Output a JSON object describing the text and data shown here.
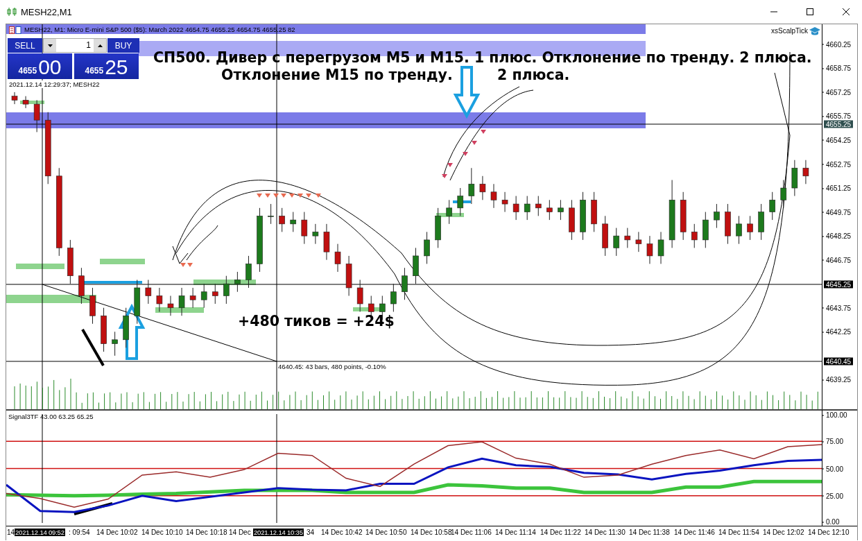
{
  "window": {
    "title": "MESH22,M1"
  },
  "chart": {
    "header": "MESH22, M1:  Micro E-mini S&P 500 ($5): March 2022  4654.75 4655.25 4654.75 4655.25  82",
    "server_time": "2021.12.14 12:29:37; MESH22",
    "expert": "xsScalpTick",
    "trade_panel": {
      "sell": {
        "label": "SELL",
        "price_base": "4655",
        "price_pips": "00"
      },
      "buy": {
        "label": "BUY",
        "price_base": "4655",
        "price_pips": "25"
      },
      "volume": "1"
    },
    "annotations": [
      "СП500. Дивер с перегрузом М5 и М15. 1 плюс. Отклонение по тренду. 2 плюса.",
      "Отклонение М15 по тренду.",
      "2 плюса.",
      "+480 тиков = +24$"
    ],
    "measure_label": "4640.45: 43 bars, 480 points, -0.10%",
    "price_markers": [
      {
        "text": "4655.25",
        "kind": "bid"
      },
      {
        "text": "4645.25",
        "kind": "line"
      },
      {
        "text": "4640.45",
        "kind": "line"
      }
    ],
    "chart_data": {
      "type": "candlestick",
      "ylim": [
        4637.4,
        4661.5
      ],
      "yticks": [
        {
          "value": 4660.25,
          "label": "4660.25"
        },
        {
          "value": 4658.75,
          "label": "4658.75"
        },
        {
          "value": 4657.25,
          "label": "4657.25"
        },
        {
          "value": 4655.75,
          "label": "4655.75"
        },
        {
          "value": 4654.25,
          "label": "4654.25"
        },
        {
          "value": 4652.75,
          "label": "4652.75"
        },
        {
          "value": 4651.25,
          "label": "4651.25"
        },
        {
          "value": 4649.75,
          "label": "4649.75"
        },
        {
          "value": 4648.25,
          "label": "4648.25"
        },
        {
          "value": 4646.75,
          "label": "4646.75"
        },
        {
          "value": 4643.75,
          "label": "4643.75"
        },
        {
          "value": 4642.25,
          "label": "4642.25"
        },
        {
          "value": 4639.25,
          "label": "4639.25"
        }
      ],
      "ohlc": [
        [
          4657,
          4657.25,
          4656.5,
          4656.75
        ],
        [
          4656.75,
          4657,
          4656.25,
          4656.5
        ],
        [
          4656.5,
          4656.75,
          4654.75,
          4655.5
        ],
        [
          4655.5,
          4656,
          4651.5,
          4652
        ],
        [
          4652,
          4652.5,
          4647,
          4647.5
        ],
        [
          4647.5,
          4648,
          4645.25,
          4645.75
        ],
        [
          4645.75,
          4646.25,
          4644,
          4644.5
        ],
        [
          4644.5,
          4645,
          4642.75,
          4643.25
        ],
        [
          4643.25,
          4643.75,
          4641,
          4641.5
        ],
        [
          4641.5,
          4642.25,
          4640.75,
          4641.75
        ],
        [
          4641.75,
          4643.75,
          4641.25,
          4643.25
        ],
        [
          4643.25,
          4645.5,
          4642.75,
          4645
        ],
        [
          4645,
          4645.5,
          4644,
          4644.5
        ],
        [
          4644.5,
          4645,
          4643.5,
          4644
        ],
        [
          4644,
          4644.5,
          4643.25,
          4643.75
        ],
        [
          4643.75,
          4645,
          4643.25,
          4644.5
        ],
        [
          4644.5,
          4645,
          4643.75,
          4644.25
        ],
        [
          4644.25,
          4645.25,
          4643.75,
          4644.75
        ],
        [
          4644.75,
          4645.25,
          4644,
          4644.5
        ],
        [
          4644.5,
          4645.75,
          4644,
          4645.25
        ],
        [
          4645.25,
          4646,
          4644.75,
          4645.5
        ],
        [
          4645.5,
          4647,
          4645,
          4646.5
        ],
        [
          4646.5,
          4650,
          4646,
          4649.5
        ],
        [
          4649.5,
          4650.25,
          4649,
          4649.5
        ],
        [
          4649.5,
          4650,
          4648.5,
          4649
        ],
        [
          4649,
          4649.75,
          4648.5,
          4649.25
        ],
        [
          4649.25,
          4649.75,
          4647.75,
          4648.25
        ],
        [
          4648.25,
          4649,
          4647.75,
          4648.5
        ],
        [
          4648.5,
          4649,
          4646.75,
          4647.25
        ],
        [
          4647.25,
          4647.75,
          4646,
          4646.5
        ],
        [
          4646.5,
          4647,
          4644.5,
          4645
        ],
        [
          4645,
          4645.5,
          4643.5,
          4644
        ],
        [
          4644,
          4644.5,
          4643,
          4643.5
        ],
        [
          4643.5,
          4644.5,
          4643,
          4644
        ],
        [
          4644,
          4645.25,
          4643.5,
          4644.75
        ],
        [
          4644.75,
          4646.25,
          4644.25,
          4645.75
        ],
        [
          4645.75,
          4647.5,
          4645.25,
          4647
        ],
        [
          4647,
          4648.5,
          4646.5,
          4648
        ],
        [
          4648,
          4650,
          4647.5,
          4649.5
        ],
        [
          4649.5,
          4650.5,
          4649,
          4650
        ],
        [
          4650,
          4651.25,
          4649.5,
          4650.75
        ],
        [
          4650.75,
          4652.5,
          4650.25,
          4651.5
        ],
        [
          4651.5,
          4652,
          4650.5,
          4651
        ],
        [
          4651,
          4651.5,
          4650,
          4650.5
        ],
        [
          4650.5,
          4651,
          4649.75,
          4650.25
        ],
        [
          4650.25,
          4650.75,
          4649.25,
          4649.75
        ],
        [
          4649.75,
          4650.75,
          4649.25,
          4650.25
        ],
        [
          4650.25,
          4650.75,
          4649.5,
          4650
        ],
        [
          4650,
          4650.5,
          4649.25,
          4649.75
        ],
        [
          4649.75,
          4650.5,
          4649.25,
          4650
        ],
        [
          4650,
          4650.5,
          4648,
          4648.5
        ],
        [
          4648.5,
          4651,
          4648,
          4650.5
        ],
        [
          4650.5,
          4651,
          4648.5,
          4649
        ],
        [
          4649,
          4649.5,
          4647,
          4647.5
        ],
        [
          4647.5,
          4648.75,
          4647,
          4648.25
        ],
        [
          4648.25,
          4648.75,
          4647.5,
          4648
        ],
        [
          4648,
          4648.5,
          4647.25,
          4647.75
        ],
        [
          4647.75,
          4648.25,
          4646.5,
          4647
        ],
        [
          4647,
          4648.5,
          4646.5,
          4648
        ],
        [
          4648,
          4651.75,
          4647.5,
          4650.5
        ],
        [
          4650.5,
          4651,
          4648,
          4648.5
        ],
        [
          4648.5,
          4649,
          4647.5,
          4648
        ],
        [
          4648,
          4649.75,
          4647.5,
          4649.25
        ],
        [
          4649.25,
          4650.25,
          4648.75,
          4649.75
        ],
        [
          4649.75,
          4650.25,
          4647.75,
          4648.25
        ],
        [
          4648.25,
          4649.5,
          4647.75,
          4649
        ],
        [
          4649,
          4649.5,
          4648,
          4648.5
        ],
        [
          4648.5,
          4650.25,
          4648,
          4649.75
        ],
        [
          4649.75,
          4651,
          4649.25,
          4650.5
        ],
        [
          4650.5,
          4651.75,
          4650,
          4651.25
        ],
        [
          4651.25,
          4653,
          4650.75,
          4652.5
        ],
        [
          4652.5,
          4653,
          4651.5,
          4652
        ]
      ]
    }
  },
  "indicator": {
    "header": "Signal3TF 43.00 63.25 65.25",
    "chart_data": {
      "type": "line",
      "ylim": [
        0,
        100
      ],
      "grid": true,
      "yticks": [
        {
          "value": 100,
          "label": "100.00"
        },
        {
          "value": 75,
          "label": "75.00"
        },
        {
          "value": 50,
          "label": "50.00"
        },
        {
          "value": 25,
          "label": "25.00"
        },
        {
          "value": 0,
          "label": "0.00"
        }
      ],
      "series": [
        {
          "color": "#3cc43c",
          "values": [
            26,
            25.5,
            25,
            25.5,
            26.5,
            27,
            28.5,
            30,
            30,
            30,
            28,
            28,
            28,
            35,
            34,
            32,
            32,
            28,
            28,
            28,
            33,
            33,
            38,
            38,
            38
          ]
        },
        {
          "color": "#0a14c0",
          "values": [
            35,
            11,
            10,
            16,
            25,
            20,
            24,
            28,
            32,
            30.5,
            30,
            36,
            36,
            51,
            59,
            53,
            51.5,
            46,
            44.5,
            40,
            45,
            48,
            53,
            57,
            58
          ]
        },
        {
          "color": "#9a2a2a",
          "values": [
            27,
            22.5,
            14.5,
            22,
            44,
            47,
            42,
            49,
            64,
            62,
            41,
            33.5,
            54,
            71,
            74.5,
            59.5,
            54,
            42,
            44,
            54,
            62,
            67,
            59,
            70,
            72
          ]
        }
      ]
    }
  },
  "time_axis": [
    {
      "text": "14",
      "highlighted": false
    },
    {
      "text": "2021.12.14 09:52",
      "highlighted": true
    },
    {
      "text": ": 09:54",
      "highlighted": false
    },
    {
      "text": "14 Dec 10:02",
      "highlighted": false
    },
    {
      "text": "14 Dec 10:10",
      "highlighted": false
    },
    {
      "text": "14 Dec 10:18",
      "highlighted": false
    },
    {
      "text": "14 Dec",
      "highlighted": false
    },
    {
      "text": "2021.12.14 10:35",
      "highlighted": true
    },
    {
      "text": "34",
      "highlighted": false
    },
    {
      "text": "14 Dec 10:42",
      "highlighted": false
    },
    {
      "text": "14 Dec 10:50",
      "highlighted": false
    },
    {
      "text": "14 Dec 10:58",
      "highlighted": false
    },
    {
      "text": "14 Dec 11:06",
      "highlighted": false
    },
    {
      "text": "14 Dec 11:14",
      "highlighted": false
    },
    {
      "text": "14 Dec 11:22",
      "highlighted": false
    },
    {
      "text": "14 Dec 11:30",
      "highlighted": false
    },
    {
      "text": "14 Dec 11:38",
      "highlighted": false
    },
    {
      "text": "14 Dec 11:46",
      "highlighted": false
    },
    {
      "text": "14 Dec 11:54",
      "highlighted": false
    },
    {
      "text": "14 Dec 12:02",
      "highlighted": false
    },
    {
      "text": "14 Dec 12:10",
      "highlighted": false
    }
  ]
}
